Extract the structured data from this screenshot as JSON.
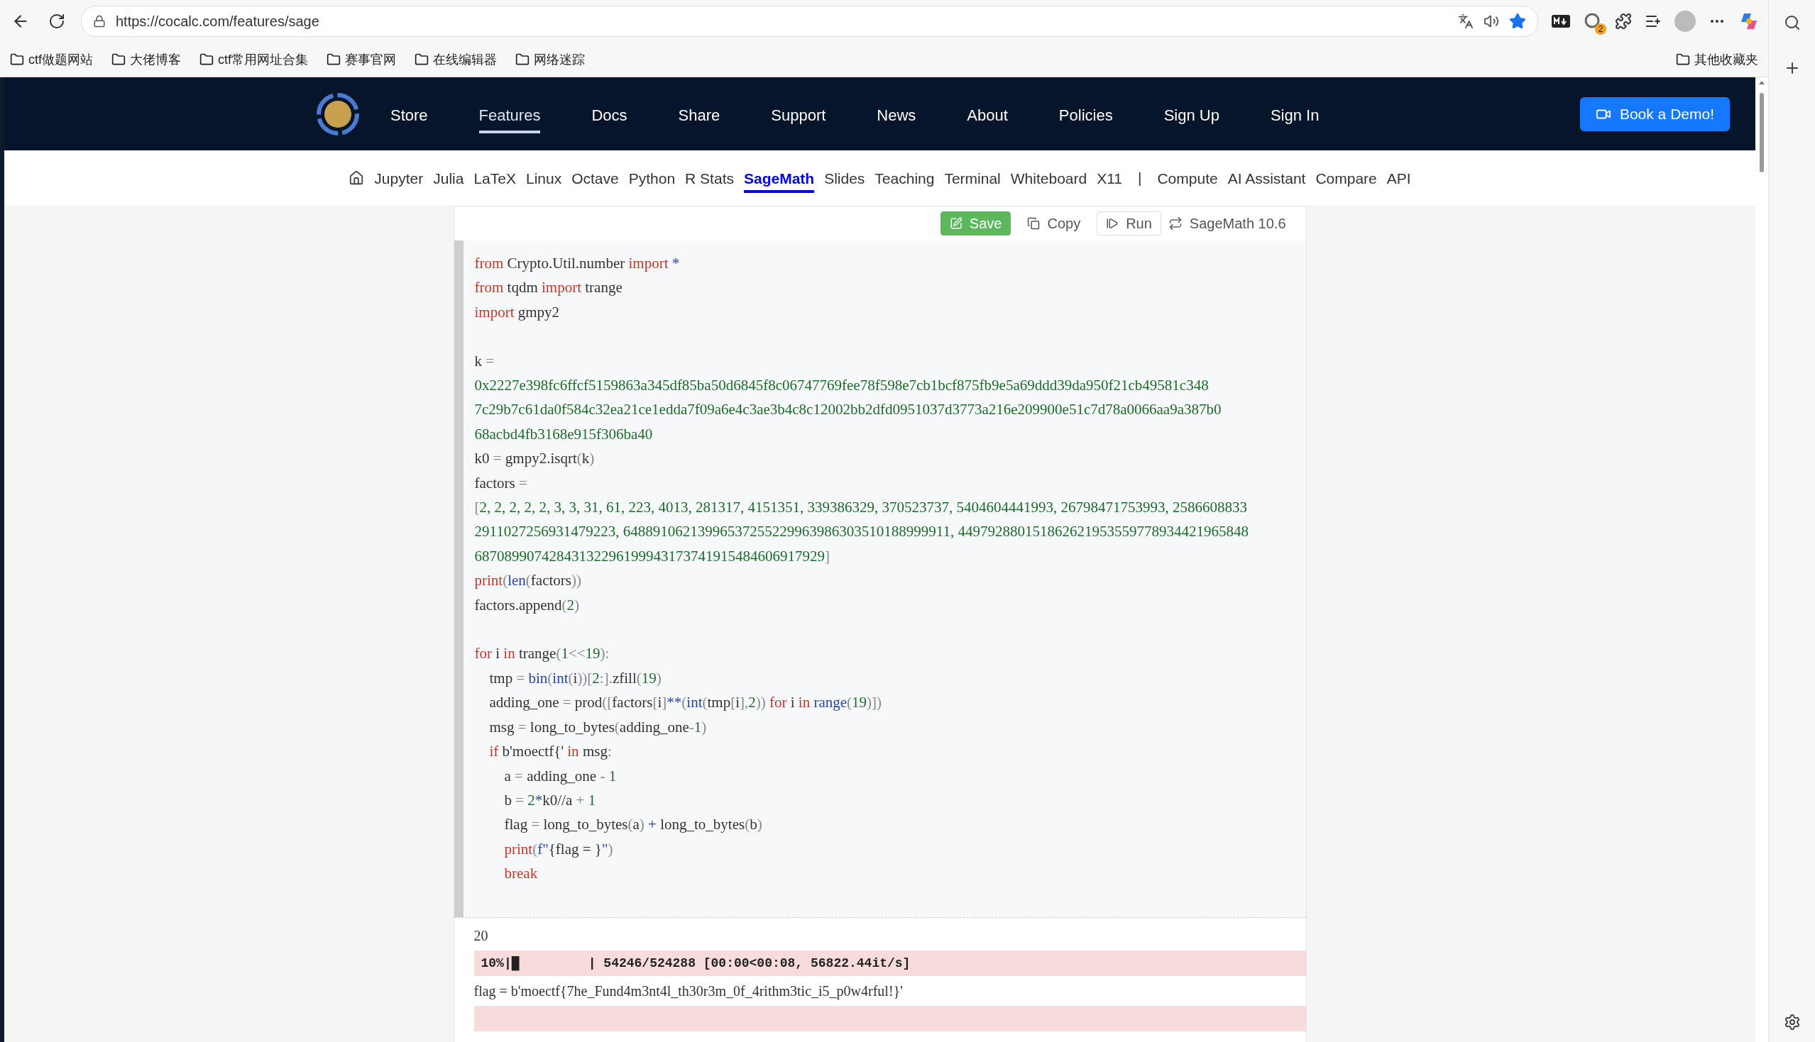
{
  "browser": {
    "address": "https://cocalc.com/features/sage",
    "extension_badge": "2",
    "bookmarks": [
      "ctf做题网站",
      "大佬博客",
      "ctf常用网址合集",
      "赛事官网",
      "在线编辑器",
      "网络迷踪"
    ],
    "other_bookmarks": "其他收藏夹"
  },
  "nav": {
    "links": [
      {
        "label": "Store",
        "selected": false
      },
      {
        "label": "Features",
        "selected": true
      },
      {
        "label": "Docs",
        "selected": false
      },
      {
        "label": "Share",
        "selected": false
      },
      {
        "label": "Support",
        "selected": false
      },
      {
        "label": "News",
        "selected": false
      },
      {
        "label": "About",
        "selected": false
      },
      {
        "label": "Policies",
        "selected": false
      },
      {
        "label": "Sign Up",
        "selected": false
      },
      {
        "label": "Sign In",
        "selected": false
      }
    ],
    "demo_button": "Book a Demo!"
  },
  "subnav": {
    "items": [
      {
        "kind": "link",
        "label": "Jupyter",
        "selected": false
      },
      {
        "kind": "link",
        "label": "Julia",
        "selected": false
      },
      {
        "kind": "link",
        "label": "LaTeX",
        "selected": false
      },
      {
        "kind": "link",
        "label": "Linux",
        "selected": false
      },
      {
        "kind": "link",
        "label": "Octave",
        "selected": false
      },
      {
        "kind": "link",
        "label": "Python",
        "selected": false
      },
      {
        "kind": "link",
        "label": "R Stats",
        "selected": false
      },
      {
        "kind": "link",
        "label": "SageMath",
        "selected": true
      },
      {
        "kind": "link",
        "label": "Slides",
        "selected": false
      },
      {
        "kind": "link",
        "label": "Teaching",
        "selected": false
      },
      {
        "kind": "link",
        "label": "Terminal",
        "selected": false
      },
      {
        "kind": "link",
        "label": "Whiteboard",
        "selected": false
      },
      {
        "kind": "link",
        "label": "X11",
        "selected": false
      },
      {
        "kind": "separator",
        "label": "|"
      },
      {
        "kind": "link",
        "label": "Compute",
        "selected": false
      },
      {
        "kind": "link",
        "label": "AI Assistant",
        "selected": false
      },
      {
        "kind": "link",
        "label": "Compare",
        "selected": false
      },
      {
        "kind": "link",
        "label": "API",
        "selected": false
      }
    ]
  },
  "editor": {
    "toolbar": {
      "save": "Save",
      "copy": "Copy",
      "run": "Run",
      "kernel": "SageMath 10.6"
    },
    "code_lines": [
      {
        "kind": "code",
        "tokens": [
          {
            "kind": "keyword",
            "text": "from"
          },
          {
            "kind": "plain",
            "text": " Crypto.Util.number "
          },
          {
            "kind": "keyword",
            "text": "import"
          },
          {
            "kind": "operator",
            "text": " *"
          }
        ]
      },
      {
        "kind": "code",
        "tokens": [
          {
            "kind": "keyword",
            "text": "from"
          },
          {
            "kind": "plain",
            "text": " tqdm "
          },
          {
            "kind": "keyword",
            "text": "import"
          },
          {
            "kind": "plain",
            "text": " trange"
          }
        ]
      },
      {
        "kind": "code",
        "tokens": [
          {
            "kind": "keyword",
            "text": "import"
          },
          {
            "kind": "plain",
            "text": " gmpy2"
          }
        ]
      },
      {
        "kind": "blank"
      },
      {
        "kind": "code",
        "tokens": [
          {
            "kind": "plain",
            "text": "k "
          },
          {
            "kind": "punct",
            "text": "="
          }
        ]
      },
      {
        "kind": "code",
        "tokens": [
          {
            "kind": "number",
            "text": "0x2227e398fc6ffcf5159863a345df85ba50d6845f8c06747769fee78f598e7cb1bcf875fb9e5a69ddd39da950f21cb49581c348"
          }
        ]
      },
      {
        "kind": "code",
        "tokens": [
          {
            "kind": "number",
            "text": "7c29b7c61da0f584c32ea21ce1edda7f09a6e4c3ae3b4c8c12002bb2dfd0951037d3773a216e209900e51c7d78a0066aa9a387b0"
          }
        ]
      },
      {
        "kind": "code",
        "tokens": [
          {
            "kind": "number",
            "text": "68acbd4fb3168e915f306ba40"
          }
        ]
      },
      {
        "kind": "code",
        "tokens": [
          {
            "kind": "plain",
            "text": "k0 "
          },
          {
            "kind": "punct",
            "text": "="
          },
          {
            "kind": "plain",
            "text": " gmpy2.isqrt"
          },
          {
            "kind": "punct",
            "text": "("
          },
          {
            "kind": "plain",
            "text": "k"
          },
          {
            "kind": "punct",
            "text": ")"
          }
        ]
      },
      {
        "kind": "code",
        "tokens": [
          {
            "kind": "plain",
            "text": "factors "
          },
          {
            "kind": "punct",
            "text": "="
          }
        ]
      },
      {
        "kind": "code",
        "tokens": [
          {
            "kind": "punct",
            "text": "["
          },
          {
            "kind": "number",
            "text": "2, 2, 2, 2, 2, 3, 3, 31, 61, 223, 4013, 281317, 4151351, 339386329, 370523737, 5404604441993, 26798471753993, 2586608833"
          }
        ]
      },
      {
        "kind": "code",
        "tokens": [
          {
            "kind": "number",
            "text": "2911027256931479223, 64889106213996537255229963986303510188999911, 449792880151862621953559778934421965848"
          }
        ]
      },
      {
        "kind": "code",
        "tokens": [
          {
            "kind": "number",
            "text": "68708990742843132296199943173741915484606917929"
          },
          {
            "kind": "punct",
            "text": "]"
          }
        ]
      },
      {
        "kind": "code",
        "tokens": [
          {
            "kind": "keyword",
            "text": "print"
          },
          {
            "kind": "punct",
            "text": "("
          },
          {
            "kind": "operator",
            "text": "len"
          },
          {
            "kind": "punct",
            "text": "("
          },
          {
            "kind": "plain",
            "text": "factors"
          },
          {
            "kind": "punct",
            "text": "))"
          }
        ]
      },
      {
        "kind": "code",
        "tokens": [
          {
            "kind": "plain",
            "text": "factors.append"
          },
          {
            "kind": "punct",
            "text": "("
          },
          {
            "kind": "number",
            "text": "2"
          },
          {
            "kind": "punct",
            "text": ")"
          }
        ]
      },
      {
        "kind": "blank"
      },
      {
        "kind": "code",
        "tokens": [
          {
            "kind": "keyword",
            "text": "for"
          },
          {
            "kind": "plain",
            "text": " i "
          },
          {
            "kind": "keyword",
            "text": "in"
          },
          {
            "kind": "plain",
            "text": " trange"
          },
          {
            "kind": "punct",
            "text": "("
          },
          {
            "kind": "number",
            "text": "1"
          },
          {
            "kind": "punct",
            "text": "<<"
          },
          {
            "kind": "number",
            "text": "19"
          },
          {
            "kind": "punct",
            "text": "):"
          }
        ]
      },
      {
        "kind": "code",
        "tokens": [
          {
            "kind": "plain",
            "text": "    tmp "
          },
          {
            "kind": "punct",
            "text": "="
          },
          {
            "kind": "operator",
            "text": " bin"
          },
          {
            "kind": "punct",
            "text": "("
          },
          {
            "kind": "operator",
            "text": "int"
          },
          {
            "kind": "punct",
            "text": "("
          },
          {
            "kind": "plain",
            "text": "i"
          },
          {
            "kind": "punct",
            "text": "))["
          },
          {
            "kind": "number",
            "text": "2"
          },
          {
            "kind": "punct",
            "text": ":]."
          },
          {
            "kind": "plain",
            "text": "zfill"
          },
          {
            "kind": "punct",
            "text": "("
          },
          {
            "kind": "number",
            "text": "19"
          },
          {
            "kind": "punct",
            "text": ")"
          }
        ]
      },
      {
        "kind": "code",
        "tokens": [
          {
            "kind": "plain",
            "text": "    adding_one "
          },
          {
            "kind": "punct",
            "text": "="
          },
          {
            "kind": "plain",
            "text": " prod"
          },
          {
            "kind": "punct",
            "text": "(["
          },
          {
            "kind": "plain",
            "text": "factors"
          },
          {
            "kind": "punct",
            "text": "["
          },
          {
            "kind": "plain",
            "text": "i"
          },
          {
            "kind": "punct",
            "text": "]"
          },
          {
            "kind": "operator",
            "text": "**"
          },
          {
            "kind": "punct",
            "text": "("
          },
          {
            "kind": "operator",
            "text": "int"
          },
          {
            "kind": "punct",
            "text": "("
          },
          {
            "kind": "plain",
            "text": "tmp"
          },
          {
            "kind": "punct",
            "text": "["
          },
          {
            "kind": "plain",
            "text": "i"
          },
          {
            "kind": "punct",
            "text": "],"
          },
          {
            "kind": "number",
            "text": "2"
          },
          {
            "kind": "punct",
            "text": "))"
          },
          {
            "kind": "keyword",
            "text": " for"
          },
          {
            "kind": "plain",
            "text": " i "
          },
          {
            "kind": "keyword",
            "text": "in"
          },
          {
            "kind": "operator",
            "text": " range"
          },
          {
            "kind": "punct",
            "text": "("
          },
          {
            "kind": "number",
            "text": "19"
          },
          {
            "kind": "punct",
            "text": ")])"
          }
        ]
      },
      {
        "kind": "code",
        "tokens": [
          {
            "kind": "plain",
            "text": "    msg "
          },
          {
            "kind": "punct",
            "text": "="
          },
          {
            "kind": "plain",
            "text": " long_to_bytes"
          },
          {
            "kind": "punct",
            "text": "("
          },
          {
            "kind": "plain",
            "text": "adding_one"
          },
          {
            "kind": "punct",
            "text": "-"
          },
          {
            "kind": "number",
            "text": "1"
          },
          {
            "kind": "punct",
            "text": ")"
          }
        ]
      },
      {
        "kind": "code",
        "tokens": [
          {
            "kind": "keyword",
            "text": "    if"
          },
          {
            "kind": "plain",
            "text": " b'moectf{' "
          },
          {
            "kind": "keyword",
            "text": "in"
          },
          {
            "kind": "plain",
            "text": " msg"
          },
          {
            "kind": "punct",
            "text": ":"
          }
        ]
      },
      {
        "kind": "code",
        "tokens": [
          {
            "kind": "plain",
            "text": "        a "
          },
          {
            "kind": "punct",
            "text": "="
          },
          {
            "kind": "plain",
            "text": " adding_one "
          },
          {
            "kind": "punct",
            "text": "-"
          },
          {
            "kind": "number",
            "text": " 1"
          }
        ]
      },
      {
        "kind": "code",
        "tokens": [
          {
            "kind": "plain",
            "text": "        b "
          },
          {
            "kind": "punct",
            "text": "="
          },
          {
            "kind": "number",
            "text": " 2"
          },
          {
            "kind": "operator",
            "text": "*"
          },
          {
            "kind": "plain",
            "text": "k0//a "
          },
          {
            "kind": "punct",
            "text": "+"
          },
          {
            "kind": "number",
            "text": " 1"
          }
        ]
      },
      {
        "kind": "code",
        "tokens": [
          {
            "kind": "plain",
            "text": "        flag "
          },
          {
            "kind": "punct",
            "text": "="
          },
          {
            "kind": "plain",
            "text": " long_to_bytes"
          },
          {
            "kind": "punct",
            "text": "("
          },
          {
            "kind": "plain",
            "text": "a"
          },
          {
            "kind": "punct",
            "text": ")"
          },
          {
            "kind": "operator",
            "text": " +"
          },
          {
            "kind": "plain",
            "text": " long_to_bytes"
          },
          {
            "kind": "punct",
            "text": "("
          },
          {
            "kind": "plain",
            "text": "b"
          },
          {
            "kind": "punct",
            "text": ")"
          }
        ]
      },
      {
        "kind": "code",
        "tokens": [
          {
            "kind": "keyword",
            "text": "        print"
          },
          {
            "kind": "punct",
            "text": "("
          },
          {
            "kind": "operator",
            "text": "f\""
          },
          {
            "kind": "plain",
            "text": "{flag = }"
          },
          {
            "kind": "operator",
            "text": "\""
          },
          {
            "kind": "punct",
            "text": ")"
          }
        ]
      },
      {
        "kind": "code",
        "tokens": [
          {
            "kind": "keyword",
            "text": "        break"
          }
        ]
      }
    ],
    "output": [
      {
        "kind": "text",
        "text": "20"
      },
      {
        "kind": "stderr",
        "text": "10%|█         | 54246/524288 [00:00<00:08, 56822.44it/s]"
      },
      {
        "kind": "text",
        "text": "flag = b'moectf{7he_Fund4m3nt4l_th30r3m_0f_4rithm3tic_i5_p0w4rful!}'"
      },
      {
        "kind": "stderr"
      }
    ]
  }
}
